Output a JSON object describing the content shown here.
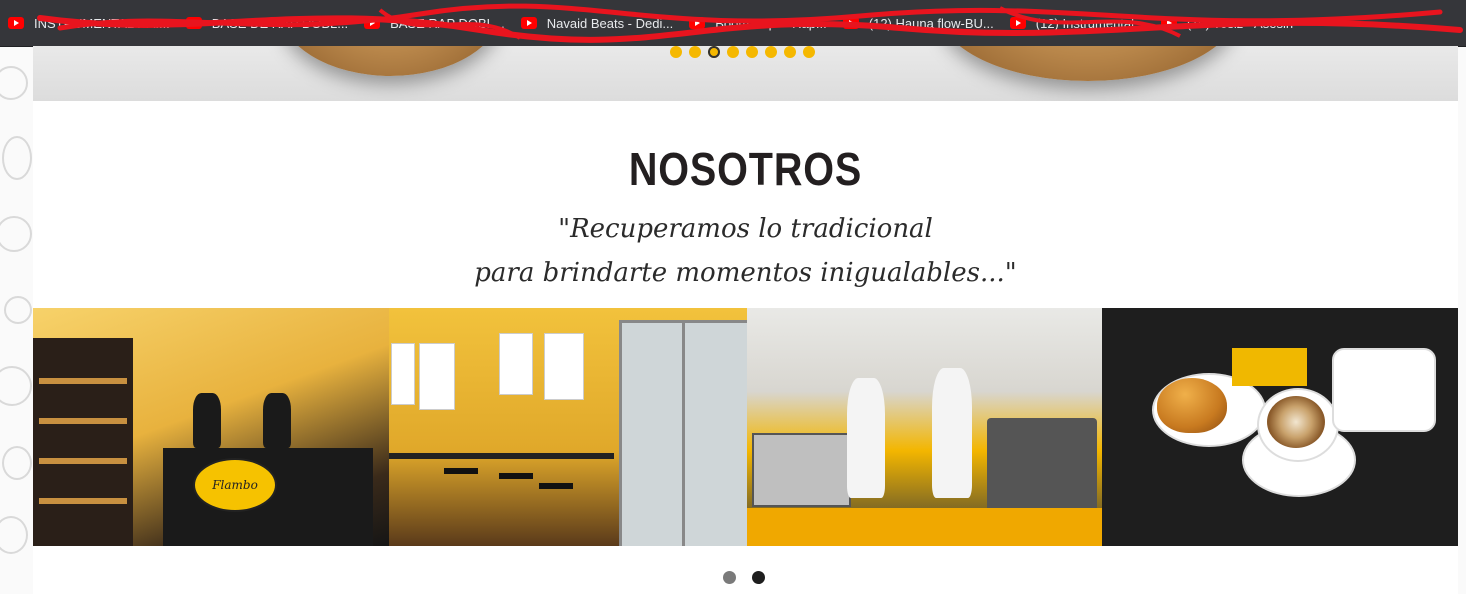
{
  "browser": {
    "bookmarks": [
      {
        "label": "INSTRUMENTAL RAI...",
        "icon": "youtube-icon"
      },
      {
        "label": "BASE DE RAP DOBL...",
        "icon": "youtube-icon"
      },
      {
        "label": "BASE RAP DOBL...",
        "icon": "youtube-icon"
      },
      {
        "label": "Navaid Beats - Dedi...",
        "icon": "youtube-icon"
      },
      {
        "label": "Boom Bap\" - Rap...",
        "icon": "youtube-icon"
      },
      {
        "label": "(12) Hauna flow-BU...",
        "icon": "youtube-icon"
      },
      {
        "label": "(12) Instrumental...",
        "icon": "youtube-icon"
      },
      {
        "label": "(10) vosiz - Asesin",
        "icon": "youtube-icon"
      }
    ],
    "bar_color": "#35363a",
    "scribble_color": "#e8141e"
  },
  "hero": {
    "slide_count": 8,
    "active_index": 2,
    "dot_color": "#f5b800"
  },
  "section": {
    "title": "NOSOTROS",
    "quote_line1": "\"Recuperamos lo tradicional",
    "quote_line2": "para brindarte momentos inigualables...\""
  },
  "gallery": {
    "photos": [
      {
        "name": "bakery-counter-photo",
        "sign": "Flambo"
      },
      {
        "name": "dining-area-photo"
      },
      {
        "name": "kitchen-photo"
      },
      {
        "name": "coffee-croissant-photo"
      }
    ],
    "page_count": 2,
    "active_page": 1
  },
  "colors": {
    "accent": "#f5b800",
    "heading": "#231f20"
  }
}
